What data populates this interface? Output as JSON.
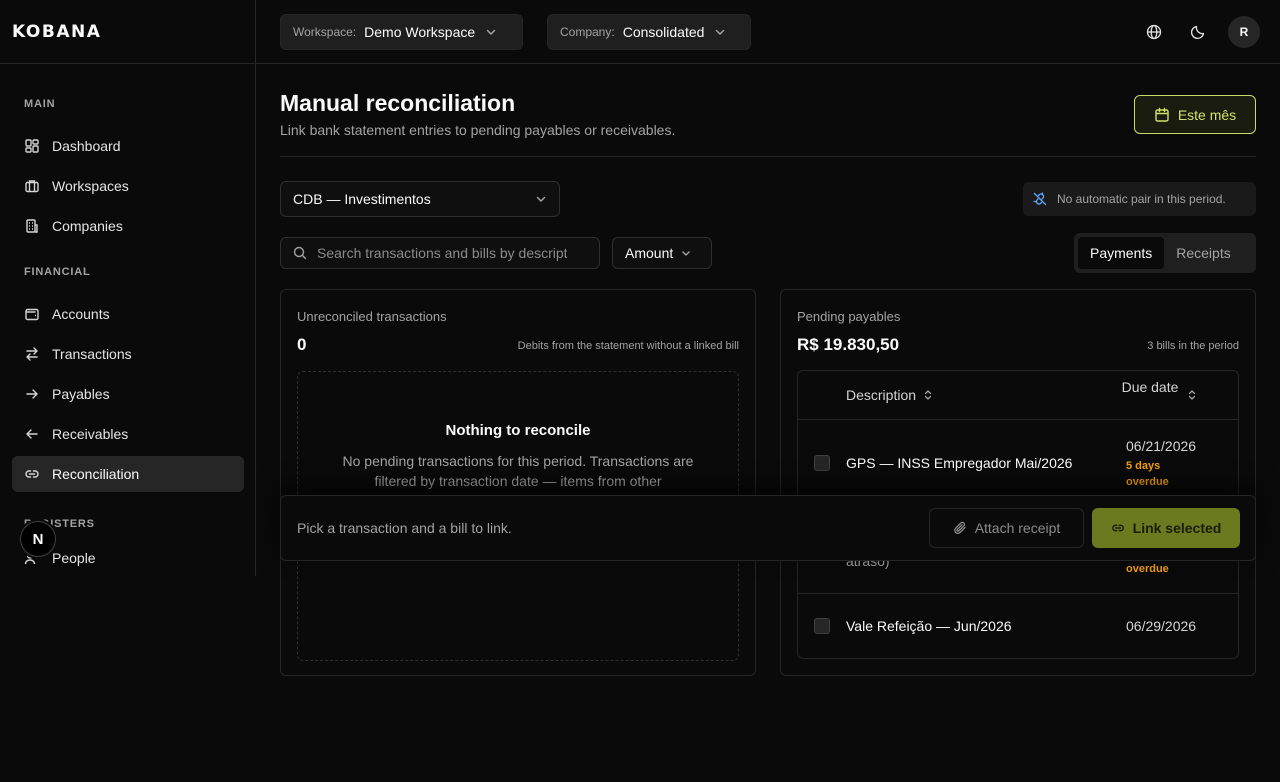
{
  "app": {
    "logo": "KOBANA"
  },
  "topbar": {
    "workspace_label": "Workspace:",
    "workspace_value": "Demo Workspace",
    "company_label": "Company:",
    "company_value": "Consolidated",
    "avatar_initial": "R"
  },
  "sidebar": {
    "sections": [
      {
        "heading": "MAIN",
        "items": [
          {
            "label": "Dashboard",
            "icon": "dashboard-icon"
          },
          {
            "label": "Workspaces",
            "icon": "briefcase-icon"
          },
          {
            "label": "Companies",
            "icon": "building-icon"
          }
        ]
      },
      {
        "heading": "FINANCIAL",
        "items": [
          {
            "label": "Accounts",
            "icon": "wallet-icon"
          },
          {
            "label": "Transactions",
            "icon": "arrows-icon"
          },
          {
            "label": "Payables",
            "icon": "arrow-right-icon"
          },
          {
            "label": "Receivables",
            "icon": "arrow-left-icon"
          },
          {
            "label": "Reconciliation",
            "icon": "link-icon",
            "active": true
          }
        ]
      },
      {
        "heading": "REGISTERS",
        "items": [
          {
            "label": "People",
            "icon": "users-icon"
          }
        ]
      }
    ],
    "floating_badge": "N"
  },
  "page": {
    "title": "Manual reconciliation",
    "subtitle": "Link bank statement entries to pending payables or receivables.",
    "date_button": "Este mês",
    "accent_color": "#c7d96a"
  },
  "filters": {
    "account_value": "CDB — Investimentos",
    "auto_pair_notice": "No automatic pair in this period.",
    "search_placeholder": "Search transactions and bills by description",
    "amount_label": "Amount",
    "segments": [
      "Payments",
      "Receipts"
    ],
    "active_segment": "Payments"
  },
  "transactions_panel": {
    "title": "Unreconciled transactions",
    "count": "0",
    "note": "Debits from the statement without a linked bill",
    "empty_title": "Nothing to reconcile",
    "empty_text": "No pending transactions for this period. Transactions are filtered by transaction date — items from other"
  },
  "payables_panel": {
    "title": "Pending payables",
    "total": "R$ 19.830,50",
    "note": "3 bills in the period",
    "columns": {
      "description": "Description",
      "due_date": "Due date"
    },
    "rows": [
      {
        "description": "GPS — INSS Empregador Mai/2026",
        "due_date": "06/21/2026",
        "overdue": "5 days overdue"
      },
      {
        "description_tail": "atraso)",
        "overdue_tail": "overdue"
      },
      {
        "description": "Vale Refeição — Jun/2026",
        "due_date": "06/29/2026"
      }
    ]
  },
  "action_bar": {
    "hint": "Pick a transaction and a bill to link.",
    "attach_label": "Attach receipt",
    "link_label": "Link selected"
  }
}
